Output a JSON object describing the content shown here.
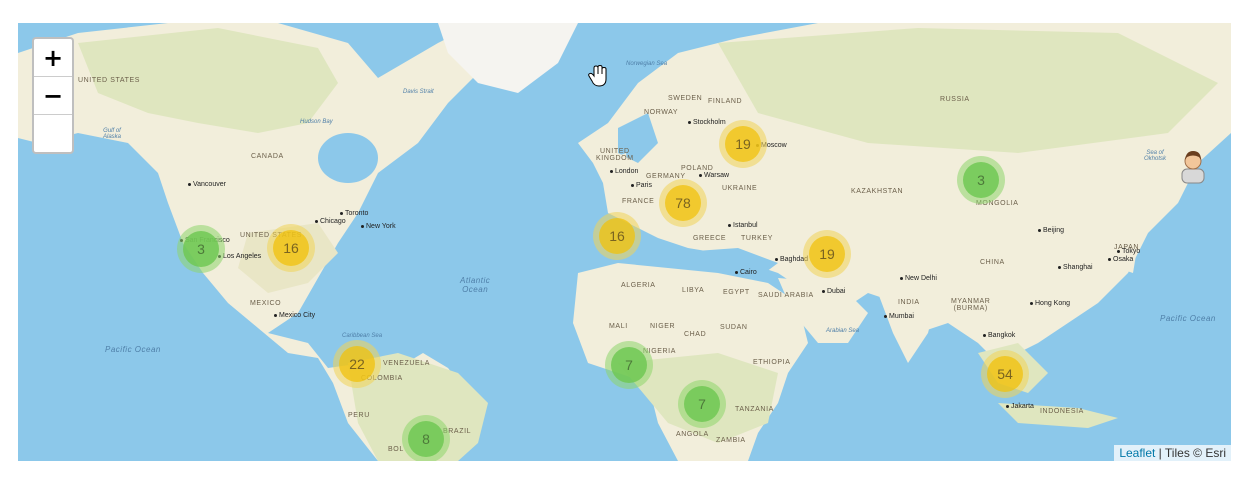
{
  "map": {
    "countries": [
      {
        "id": "united-states-top",
        "text": "UNITED STATES"
      },
      {
        "id": "canada",
        "text": "CANADA"
      },
      {
        "id": "united-states",
        "text": "UNITED STATES"
      },
      {
        "id": "mexico",
        "text": "MEXICO"
      },
      {
        "id": "venezuela",
        "text": "VENEZUELA"
      },
      {
        "id": "colombia",
        "text": "COLOMBIA"
      },
      {
        "id": "peru",
        "text": "PERU"
      },
      {
        "id": "bolivia",
        "text": "BOL"
      },
      {
        "id": "brazil",
        "text": "BRAZIL"
      },
      {
        "id": "sweden",
        "text": "SWEDEN"
      },
      {
        "id": "finland",
        "text": "FINLAND"
      },
      {
        "id": "norway",
        "text": "NORWAY"
      },
      {
        "id": "united-kingdom",
        "text": "UNITED\nKINGDOM"
      },
      {
        "id": "germany",
        "text": "GERMANY"
      },
      {
        "id": "poland",
        "text": "POLAND"
      },
      {
        "id": "ukraine",
        "text": "UKRAINE"
      },
      {
        "id": "france",
        "text": "FRANCE"
      },
      {
        "id": "greece",
        "text": "GREECE"
      },
      {
        "id": "turkey",
        "text": "TURKEY"
      },
      {
        "id": "russia",
        "text": "RUSSIA"
      },
      {
        "id": "kazakhstan",
        "text": "KAZAKHSTAN"
      },
      {
        "id": "mongolia",
        "text": "MONGOLIA"
      },
      {
        "id": "china",
        "text": "CHINA"
      },
      {
        "id": "japan",
        "text": "JAPAN"
      },
      {
        "id": "india",
        "text": "INDIA"
      },
      {
        "id": "myanmar",
        "text": "MYANMAR\n(BURMA)"
      },
      {
        "id": "indonesia",
        "text": "INDONESIA"
      },
      {
        "id": "algeria",
        "text": "ALGERIA"
      },
      {
        "id": "libya",
        "text": "LIBYA"
      },
      {
        "id": "egypt",
        "text": "EGYPT"
      },
      {
        "id": "saudi-arabia",
        "text": "SAUDI ARABIA"
      },
      {
        "id": "mali",
        "text": "MALI"
      },
      {
        "id": "niger",
        "text": "NIGER"
      },
      {
        "id": "chad",
        "text": "CHAD"
      },
      {
        "id": "sudan",
        "text": "SUDAN"
      },
      {
        "id": "nigeria",
        "text": "NIGERIA"
      },
      {
        "id": "ethiopia",
        "text": "ETHIOPIA"
      },
      {
        "id": "tanzania",
        "text": "TANZANIA"
      },
      {
        "id": "angola",
        "text": "ANGOLA"
      },
      {
        "id": "zambia",
        "text": "ZAMBIA"
      }
    ],
    "cities": [
      {
        "id": "vancouver",
        "text": "Vancouver"
      },
      {
        "id": "toronto",
        "text": "Toronto"
      },
      {
        "id": "chicago",
        "text": "Chicago"
      },
      {
        "id": "new-york",
        "text": "New York"
      },
      {
        "id": "san-francisco",
        "text": "San Francisco"
      },
      {
        "id": "los-angeles",
        "text": "Los Angeles"
      },
      {
        "id": "mexico-city",
        "text": "Mexico City"
      },
      {
        "id": "stockholm",
        "text": "Stockholm"
      },
      {
        "id": "moscow",
        "text": "Moscow"
      },
      {
        "id": "london",
        "text": "London"
      },
      {
        "id": "warsaw",
        "text": "Warsaw"
      },
      {
        "id": "paris",
        "text": "Paris"
      },
      {
        "id": "istanbul",
        "text": "Istanbul"
      },
      {
        "id": "cairo",
        "text": "Cairo"
      },
      {
        "id": "baghdad",
        "text": "Baghdad"
      },
      {
        "id": "dubai",
        "text": "Dubai"
      },
      {
        "id": "new-delhi",
        "text": "New Delhi"
      },
      {
        "id": "mumbai",
        "text": "Mumbai"
      },
      {
        "id": "beijing",
        "text": "Beijing"
      },
      {
        "id": "shanghai",
        "text": "Shanghai"
      },
      {
        "id": "tokyo",
        "text": "Tokyo"
      },
      {
        "id": "osaka",
        "text": "Osaka"
      },
      {
        "id": "hong-kong",
        "text": "Hong Kong"
      },
      {
        "id": "bangkok",
        "text": "Bangkok"
      },
      {
        "id": "jakarta",
        "text": "Jakarta"
      }
    ],
    "waters": [
      {
        "id": "pacific-ocean-west",
        "text": "Pacific Ocean",
        "kind": "ocean"
      },
      {
        "id": "atlantic-ocean",
        "text": "Atlantic\nOcean",
        "kind": "ocean"
      },
      {
        "id": "pacific-ocean-east",
        "text": "Pacific Ocean",
        "kind": "ocean"
      },
      {
        "id": "hudson-bay",
        "text": "Hudson Bay",
        "kind": "sea"
      },
      {
        "id": "davis-strait",
        "text": "Davis Strait",
        "kind": "sea"
      },
      {
        "id": "norwegian-sea",
        "text": "Norwegian Sea",
        "kind": "sea"
      },
      {
        "id": "gulf-of-alaska",
        "text": "Gulf of\nAlaska",
        "kind": "sea"
      },
      {
        "id": "caribbean-sea",
        "text": "Caribbean Sea",
        "kind": "sea"
      },
      {
        "id": "arabian-sea",
        "text": "Arabian Sea",
        "kind": "sea"
      },
      {
        "id": "sea-of-okhotsk",
        "text": "Sea of\nOkhotsk",
        "kind": "sea"
      }
    ],
    "clusters": [
      {
        "id": "west-us",
        "count": "3",
        "size": "small"
      },
      {
        "id": "central-us",
        "count": "16",
        "size": "medium"
      },
      {
        "id": "caribbean",
        "count": "22",
        "size": "medium"
      },
      {
        "id": "brazil",
        "count": "8",
        "size": "small"
      },
      {
        "id": "iberia",
        "count": "16",
        "size": "medium"
      },
      {
        "id": "europe",
        "count": "78",
        "size": "medium"
      },
      {
        "id": "moscow",
        "count": "19",
        "size": "medium"
      },
      {
        "id": "middle-east",
        "count": "19",
        "size": "medium"
      },
      {
        "id": "west-africa",
        "count": "7",
        "size": "small"
      },
      {
        "id": "central-africa",
        "count": "7",
        "size": "small"
      },
      {
        "id": "mongolia",
        "count": "3",
        "size": "small"
      },
      {
        "id": "southeast-asia",
        "count": "54",
        "size": "medium"
      }
    ]
  },
  "controls": {
    "zoom_in": "+",
    "zoom_out": "−"
  },
  "attribution": {
    "leaflet": "Leaflet",
    "separator": " | ",
    "tiles": "Tiles © Esri"
  },
  "icons": {
    "zoom_in": "plus-icon",
    "zoom_out": "minus-icon",
    "user_marker": "user-avatar-icon",
    "cursor": "hand-cursor-icon"
  },
  "colors": {
    "ocean": "#8cc8ea",
    "land": "#f2eedb",
    "vegetation": "#dfe6bf",
    "cluster_small": "#70c854",
    "cluster_medium": "#f0c20c",
    "link": "#0078a8"
  }
}
